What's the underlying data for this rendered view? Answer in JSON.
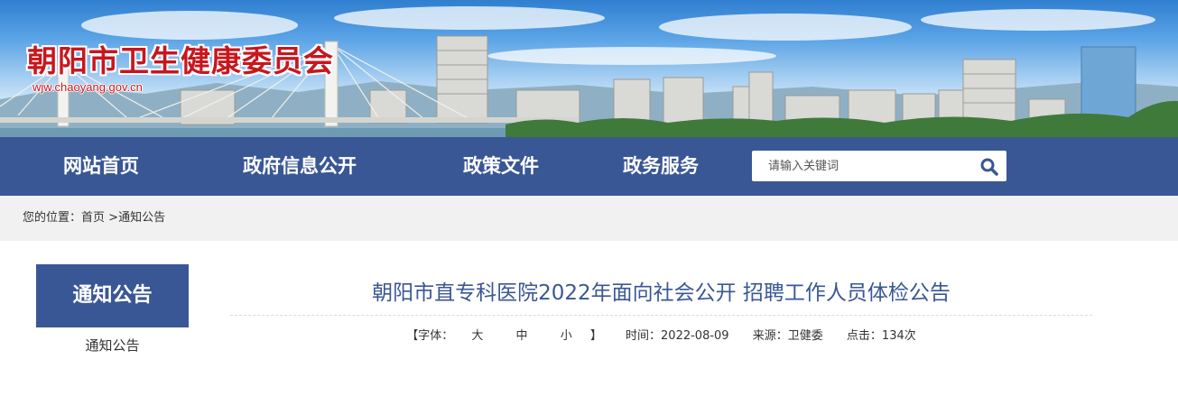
{
  "header": {
    "site_title": "朝阳市卫生健康委员会",
    "site_domain": "wjw.chaoyang.gov.cn"
  },
  "nav": {
    "items": [
      "网站首页",
      "政府信息公开",
      "政策文件",
      "政务服务"
    ],
    "search_placeholder": "请输入关键词",
    "search_icon": "search-icon"
  },
  "breadcrumb": {
    "prefix": "您的位置：",
    "home": "首页",
    "separator": " >",
    "current": "通知公告"
  },
  "sidebar": {
    "heading": "通知公告",
    "items": [
      "通知公告"
    ]
  },
  "article": {
    "title": "朝阳市直专科医院2022年面向社会公开 招聘工作人员体检公告",
    "font_label": "【字体：",
    "font_sizes": [
      "大",
      "中",
      "小"
    ],
    "font_close": "】",
    "date_label": "时间：",
    "date": "2022-08-09",
    "source_label": "来源：",
    "source": "卫健委",
    "clicks_label": "点击：",
    "clicks": "134次"
  },
  "colors": {
    "nav_bg": "#3a5795",
    "title_red": "#c8161d",
    "title_blue": "#3a5795",
    "crumb_bg": "#f1f1f1"
  }
}
